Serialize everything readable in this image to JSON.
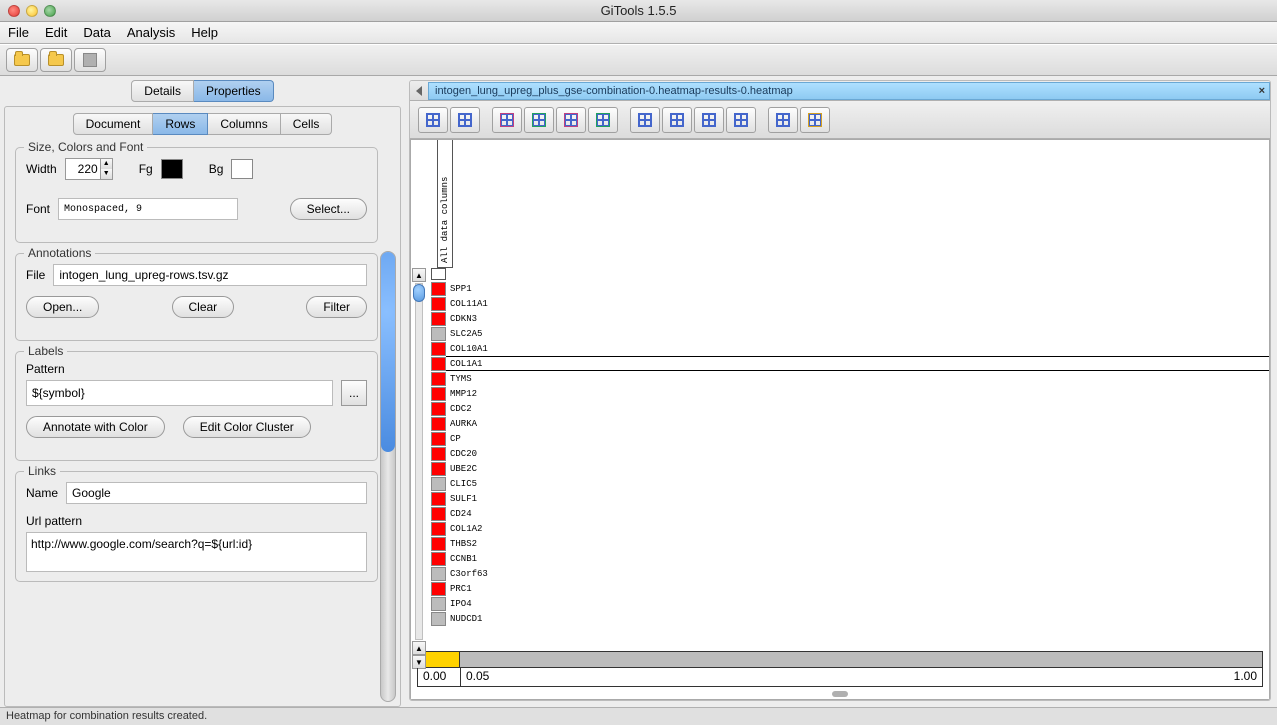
{
  "app": {
    "title": "GiTools 1.5.5"
  },
  "menubar": [
    "File",
    "Edit",
    "Data",
    "Analysis",
    "Help"
  ],
  "left": {
    "outer_tabs": [
      "Details",
      "Properties"
    ],
    "outer_active": 1,
    "inner_tabs": [
      "Document",
      "Rows",
      "Columns",
      "Cells"
    ],
    "inner_active": 1,
    "size_group": {
      "title": "Size, Colors and Font",
      "width_label": "Width",
      "width_value": "220",
      "fg_label": "Fg",
      "bg_label": "Bg",
      "font_label": "Font",
      "font_value": "Monospaced, 9",
      "select_btn": "Select..."
    },
    "annotations": {
      "title": "Annotations",
      "file_label": "File",
      "file_value": "intogen_lung_upreg-rows.tsv.gz",
      "open_btn": "Open...",
      "clear_btn": "Clear",
      "filter_btn": "Filter"
    },
    "labels": {
      "title": "Labels",
      "pattern_label": "Pattern",
      "pattern_value": "${symbol}",
      "dots_btn": "...",
      "annotate_btn": "Annotate with Color",
      "edit_cluster_btn": "Edit Color Cluster"
    },
    "links": {
      "title": "Links",
      "name_label": "Name",
      "name_value": "Google",
      "url_label": "Url pattern",
      "url_value": "http://www.google.com/search?q=${url:id}"
    }
  },
  "right": {
    "doc_title": "intogen_lung_upreg_plus_gse-combination-0.heatmap-results-0.heatmap",
    "col_label": "All data columns",
    "genes": [
      {
        "name": "SPP1",
        "color": "red"
      },
      {
        "name": "COL11A1",
        "color": "red"
      },
      {
        "name": "CDKN3",
        "color": "red"
      },
      {
        "name": "SLC2A5",
        "color": "gray"
      },
      {
        "name": "COL10A1",
        "color": "red"
      },
      {
        "name": "COL1A1",
        "color": "red",
        "selected": true
      },
      {
        "name": "TYMS",
        "color": "red"
      },
      {
        "name": "MMP12",
        "color": "red"
      },
      {
        "name": "CDC2",
        "color": "red"
      },
      {
        "name": "AURKA",
        "color": "red"
      },
      {
        "name": "CP",
        "color": "red"
      },
      {
        "name": "CDC20",
        "color": "red"
      },
      {
        "name": "UBE2C",
        "color": "red"
      },
      {
        "name": "CLIC5",
        "color": "gray"
      },
      {
        "name": "SULF1",
        "color": "red"
      },
      {
        "name": "CD24",
        "color": "red"
      },
      {
        "name": "COL1A2",
        "color": "red"
      },
      {
        "name": "THBS2",
        "color": "red"
      },
      {
        "name": "CCNB1",
        "color": "red"
      },
      {
        "name": "C3orf63",
        "color": "gray"
      },
      {
        "name": "PRC1",
        "color": "red"
      },
      {
        "name": "IPO4",
        "color": "gray"
      },
      {
        "name": "NUDCD1",
        "color": "gray"
      }
    ],
    "scale": {
      "low": "0.00",
      "mid": "0.05",
      "high": "1.00"
    }
  },
  "status": "Heatmap for combination results created."
}
